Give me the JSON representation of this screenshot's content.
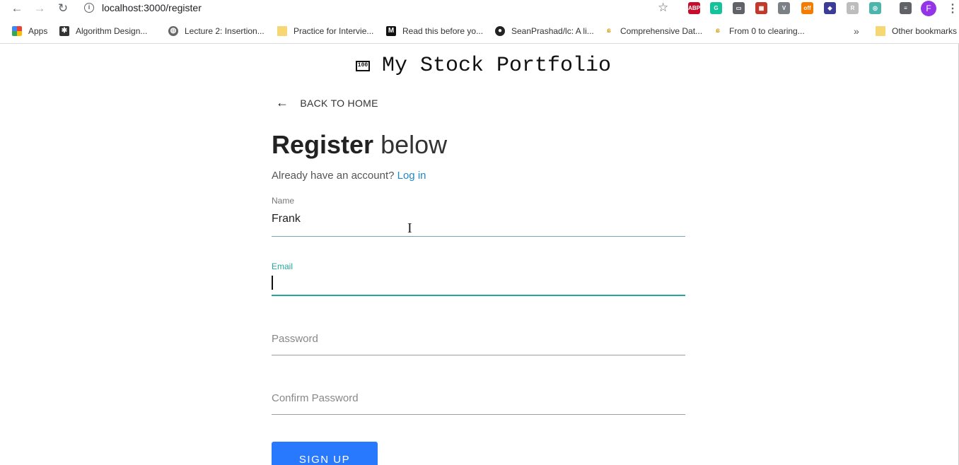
{
  "browser": {
    "url": "localhost:3000/register",
    "profile_initial": "F",
    "bookmarks": [
      {
        "label": "Apps",
        "icon": "apps-grid-icon"
      },
      {
        "label": "Algorithm Design...",
        "icon": "gear-logo-icon"
      },
      {
        "label": "Lecture 2: Insertion...",
        "icon": "globe-icon"
      },
      {
        "label": "Practice for Intervie...",
        "icon": "doc-icon"
      },
      {
        "label": "Read this before yo...",
        "icon": "medium-icon"
      },
      {
        "label": "SeanPrashad/lc: A li...",
        "icon": "github-icon"
      },
      {
        "label": "Comprehensive Dat...",
        "icon": "bookmark-icon"
      },
      {
        "label": "From 0 to clearing...",
        "icon": "bookmark-icon"
      }
    ],
    "more_label": "»",
    "other_bookmarks": "Other bookmarks",
    "extensions": [
      {
        "name": "abp-extension-icon",
        "text": "ABP",
        "color": "#c70d2c"
      },
      {
        "name": "grammarly-extension-icon",
        "text": "G",
        "color": "#15c39a"
      },
      {
        "name": "cast-extension-icon",
        "text": "▭",
        "color": "#5f6368"
      },
      {
        "name": "puzzle-extension-icon",
        "text": "▦",
        "color": "#c0392b"
      },
      {
        "name": "vue-extension-icon",
        "text": "V",
        "color": "#7a8085"
      },
      {
        "name": "off-extension-icon",
        "text": "off",
        "color": "#f57c00"
      },
      {
        "name": "flow-extension-icon",
        "text": "◆",
        "color": "#3b3b98"
      },
      {
        "name": "r-extension-icon",
        "text": "R",
        "color": "#bdbdbd"
      },
      {
        "name": "target-extension-icon",
        "text": "◎",
        "color": "#4db6ac"
      },
      {
        "name": "playlist-extension-icon",
        "text": "≡",
        "color": "#5f6368"
      }
    ]
  },
  "app": {
    "title": "My Stock Portfolio",
    "title_icon": "100",
    "back_label": "BACK TO HOME",
    "heading_bold": "Register",
    "heading_light": " below",
    "account_prompt": "Already have an account? ",
    "login_link": "Log in",
    "form": {
      "name_label": "Name",
      "name_value": "Frank",
      "email_label": "Email",
      "email_value": "",
      "password_placeholder": "Password",
      "confirm_placeholder": "Confirm Password",
      "submit_label": "SIGN UP"
    },
    "accent_color": "#2979ff",
    "focus_color": "#26a69a",
    "link_color": "#1e88c9"
  }
}
